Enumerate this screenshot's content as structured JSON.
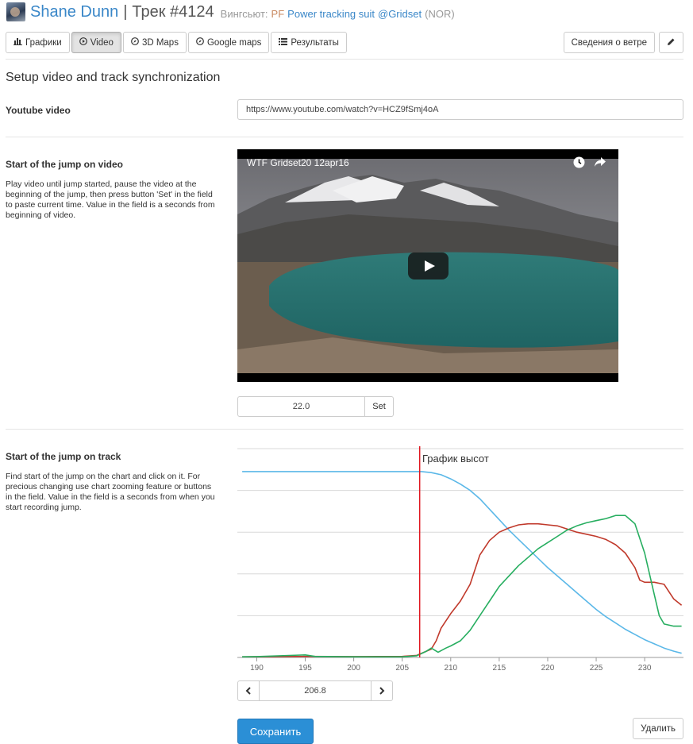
{
  "header": {
    "pilot_name": "Shane Dunn",
    "separator": "|",
    "track_title": "Трек #4124",
    "suit_label": "Вингсьют:",
    "suit_brand": "PF",
    "suit_name": "Power tracking suit",
    "place": "@Gridset",
    "country": "(NOR)"
  },
  "tabs": [
    {
      "label": "Графики",
      "icon": "bar-chart-icon",
      "active": false
    },
    {
      "label": "Video",
      "icon": "play-circle-icon",
      "active": true
    },
    {
      "label": "3D Maps",
      "icon": "compass-icon",
      "active": false
    },
    {
      "label": "Google maps",
      "icon": "compass-icon",
      "active": false
    },
    {
      "label": "Результаты",
      "icon": "list-icon",
      "active": false
    }
  ],
  "toolbar": {
    "wind_label": "Сведения о ветре",
    "edit_icon": "pencil-icon"
  },
  "page": {
    "title": "Setup video and track synchronization"
  },
  "youtube": {
    "label": "Youtube video",
    "url": "https://www.youtube.com/watch?v=HCZ9fSmj4oA"
  },
  "video_start": {
    "label": "Start of the jump on video",
    "help": "Play video until jump started, pause the video at the beginning of the jump, then press button 'Set' in the field to paste current time. Value in the field is a seconds from beginning of video.",
    "video_title": "WTF Gridset20 12apr16",
    "value": "22.0",
    "set_label": "Set"
  },
  "track_start": {
    "label": "Start of the jump on track",
    "help": "Find start of the jump on the chart and click on it. For precious changing use chart zooming feature or buttons in the field. Value in the field is a seconds from when you start recording jump.",
    "value": "206.8"
  },
  "colors": {
    "accent": "#2b8fd6",
    "link": "#3a87c8",
    "altitude": "#5bb8e8",
    "hspeed": "#c0392b",
    "vspeed": "#27ae60",
    "marker": "#e0161f"
  },
  "chart_data": {
    "type": "line",
    "title": "График высот",
    "xlim": [
      188,
      234
    ],
    "x_ticks": [
      "190",
      "195",
      "200",
      "205",
      "210",
      "215",
      "220",
      "225",
      "230"
    ],
    "grid": true,
    "marker_x": 206.8,
    "series": [
      {
        "key": "altitude",
        "points": [
          [
            188.5,
            0.89
          ],
          [
            195,
            0.89
          ],
          [
            200,
            0.89
          ],
          [
            205,
            0.89
          ],
          [
            207,
            0.89
          ],
          [
            208,
            0.885
          ],
          [
            209,
            0.875
          ],
          [
            210,
            0.855
          ],
          [
            211,
            0.83
          ],
          [
            212,
            0.8
          ],
          [
            213,
            0.76
          ],
          [
            214,
            0.71
          ],
          [
            215,
            0.66
          ],
          [
            216,
            0.61
          ],
          [
            217,
            0.565
          ],
          [
            218,
            0.52
          ],
          [
            219,
            0.475
          ],
          [
            220,
            0.43
          ],
          [
            221,
            0.39
          ],
          [
            222,
            0.35
          ],
          [
            223,
            0.31
          ],
          [
            224,
            0.27
          ],
          [
            225,
            0.23
          ],
          [
            226,
            0.195
          ],
          [
            227,
            0.165
          ],
          [
            228,
            0.135
          ],
          [
            229,
            0.11
          ],
          [
            230,
            0.085
          ],
          [
            231,
            0.065
          ],
          [
            232,
            0.045
          ],
          [
            233,
            0.03
          ],
          [
            233.8,
            0.02
          ]
        ]
      },
      {
        "key": "hspeed",
        "points": [
          [
            188.5,
            0.003
          ],
          [
            195,
            0.005
          ],
          [
            200,
            0.004
          ],
          [
            205,
            0.005
          ],
          [
            206.5,
            0.01
          ],
          [
            207.5,
            0.03
          ],
          [
            208,
            0.04
          ],
          [
            208.5,
            0.08
          ],
          [
            209,
            0.14
          ],
          [
            210,
            0.21
          ],
          [
            211,
            0.27
          ],
          [
            212,
            0.35
          ],
          [
            212.5,
            0.42
          ],
          [
            213,
            0.49
          ],
          [
            214,
            0.56
          ],
          [
            215,
            0.6
          ],
          [
            216,
            0.62
          ],
          [
            217,
            0.635
          ],
          [
            218,
            0.64
          ],
          [
            219,
            0.64
          ],
          [
            220,
            0.635
          ],
          [
            221,
            0.63
          ],
          [
            222,
            0.615
          ],
          [
            223,
            0.6
          ],
          [
            224,
            0.59
          ],
          [
            225,
            0.58
          ],
          [
            226,
            0.565
          ],
          [
            227,
            0.54
          ],
          [
            228,
            0.5
          ],
          [
            229,
            0.43
          ],
          [
            229.5,
            0.37
          ],
          [
            230,
            0.36
          ],
          [
            231,
            0.36
          ],
          [
            232,
            0.35
          ],
          [
            233,
            0.28
          ],
          [
            233.8,
            0.25
          ]
        ]
      },
      {
        "key": "vspeed",
        "points": [
          [
            188.5,
            0.003
          ],
          [
            190,
            0.004
          ],
          [
            195,
            0.012
          ],
          [
            196,
            0.005
          ],
          [
            200,
            0.003
          ],
          [
            205,
            0.003
          ],
          [
            206.5,
            0.008
          ],
          [
            207.5,
            0.03
          ],
          [
            208,
            0.045
          ],
          [
            208.7,
            0.025
          ],
          [
            209.5,
            0.045
          ],
          [
            210,
            0.055
          ],
          [
            211,
            0.08
          ],
          [
            212,
            0.13
          ],
          [
            213,
            0.2
          ],
          [
            214,
            0.27
          ],
          [
            215,
            0.34
          ],
          [
            216,
            0.39
          ],
          [
            217,
            0.44
          ],
          [
            218,
            0.48
          ],
          [
            219,
            0.52
          ],
          [
            220,
            0.55
          ],
          [
            221,
            0.58
          ],
          [
            222,
            0.61
          ],
          [
            223,
            0.63
          ],
          [
            224,
            0.645
          ],
          [
            225,
            0.655
          ],
          [
            226,
            0.665
          ],
          [
            227,
            0.68
          ],
          [
            228,
            0.68
          ],
          [
            228.5,
            0.66
          ],
          [
            229,
            0.64
          ],
          [
            230,
            0.5
          ],
          [
            231,
            0.3
          ],
          [
            231.5,
            0.2
          ],
          [
            232,
            0.16
          ],
          [
            233,
            0.15
          ],
          [
            233.8,
            0.15
          ]
        ]
      }
    ]
  },
  "actions": {
    "save_label": "Сохранить",
    "delete_label": "Удалить"
  }
}
